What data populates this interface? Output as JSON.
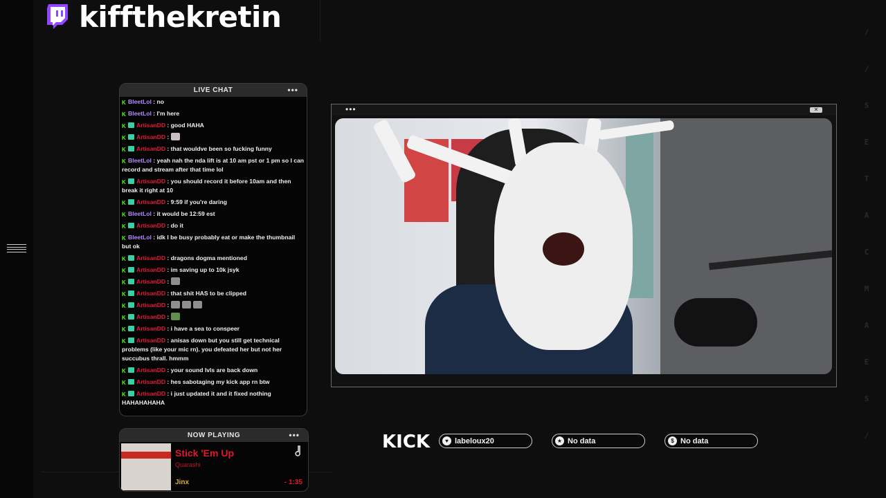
{
  "header": {
    "channel_name": "kiffthekretin",
    "platform_icon": "twitch-icon"
  },
  "chat": {
    "title": "LIVE CHAT",
    "more_icon": "•••",
    "messages": [
      {
        "user": "BleetLol",
        "color": "purple",
        "sub": false,
        "text": "no"
      },
      {
        "user": "BleetLol",
        "color": "purple",
        "sub": false,
        "text": "I'm here"
      },
      {
        "user": "ArtisanDD",
        "color": "red",
        "sub": true,
        "text": "good HAHA"
      },
      {
        "user": "ArtisanDD",
        "color": "red",
        "sub": true,
        "text": "",
        "emotes": [
          "face"
        ]
      },
      {
        "user": "ArtisanDD",
        "color": "red",
        "sub": true,
        "text": "that wouldve been so fucking funny"
      },
      {
        "user": "BleetLol",
        "color": "purple",
        "sub": false,
        "text": "yeah nah the nda lift is at 10 am pst or 1 pm so I can record and stream after that time lol"
      },
      {
        "user": "ArtisanDD",
        "color": "red",
        "sub": true,
        "text": "you should record it before 10am and then break it right at 10"
      },
      {
        "user": "ArtisanDD",
        "color": "red",
        "sub": true,
        "text": "9:59 if you're daring"
      },
      {
        "user": "BleetLol",
        "color": "purple",
        "sub": false,
        "text": "it would be 12:59 est"
      },
      {
        "user": "ArtisanDD",
        "color": "red",
        "sub": true,
        "text": "do it"
      },
      {
        "user": "BleetLol",
        "color": "purple",
        "sub": false,
        "text": "idk I be busy probably eat or make the thumbnail but ok"
      },
      {
        "user": "ArtisanDD",
        "color": "red",
        "sub": true,
        "text": "dragons dogma mentioned"
      },
      {
        "user": "ArtisanDD",
        "color": "red",
        "sub": true,
        "text": "im saving up to 10k jsyk"
      },
      {
        "user": "ArtisanDD",
        "color": "red",
        "sub": true,
        "text": "",
        "emotes": [
          "gun"
        ]
      },
      {
        "user": "ArtisanDD",
        "color": "red",
        "sub": true,
        "text": "that shit HAS to be clipped"
      },
      {
        "user": "ArtisanDD",
        "color": "red",
        "sub": true,
        "text": "",
        "emotes": [
          "gun",
          "gun",
          "gun"
        ]
      },
      {
        "user": "ArtisanDD",
        "color": "red",
        "sub": true,
        "text": "",
        "emotes": [
          "frog"
        ]
      },
      {
        "user": "ArtisanDD",
        "color": "red",
        "sub": true,
        "text": "i have a sea to conspeer"
      },
      {
        "user": "ArtisanDD",
        "color": "red",
        "sub": true,
        "text": "anisas down but you still get technical problems (like your mic rn). you defeated her but not her succubus thrall. hmmm"
      },
      {
        "user": "ArtisanDD",
        "color": "red",
        "sub": true,
        "text": "your sound lvls are back down"
      },
      {
        "user": "ArtisanDD",
        "color": "red",
        "sub": true,
        "text": "hes sabotaging my kick app rn btw"
      },
      {
        "user": "ArtisanDD",
        "color": "red",
        "sub": true,
        "text": "i just updated it and it fixed nothing HAHAHAHAHA"
      }
    ]
  },
  "now_playing": {
    "title": "NOW PLAYING",
    "more_icon": "•••",
    "track": "Stick 'Em Up",
    "artist": "Quarashi",
    "album": "Jinx",
    "time": "- 1:35",
    "icon": "music-note-icon"
  },
  "camera": {
    "dots": "•••",
    "close_label": "✕"
  },
  "kick": {
    "logo": "KICK",
    "stats": [
      {
        "icon": "heart-icon",
        "glyph": "♥",
        "label": "labeloux20"
      },
      {
        "icon": "star-icon",
        "glyph": "★",
        "label": "No data"
      },
      {
        "icon": "dollar-icon",
        "glyph": "$",
        "label": "No data"
      }
    ]
  },
  "colors": {
    "kick_green": "#53fc18",
    "user_purple": "#b389ff",
    "user_red": "#e11b3a",
    "twitch_purple": "#9146ff"
  }
}
